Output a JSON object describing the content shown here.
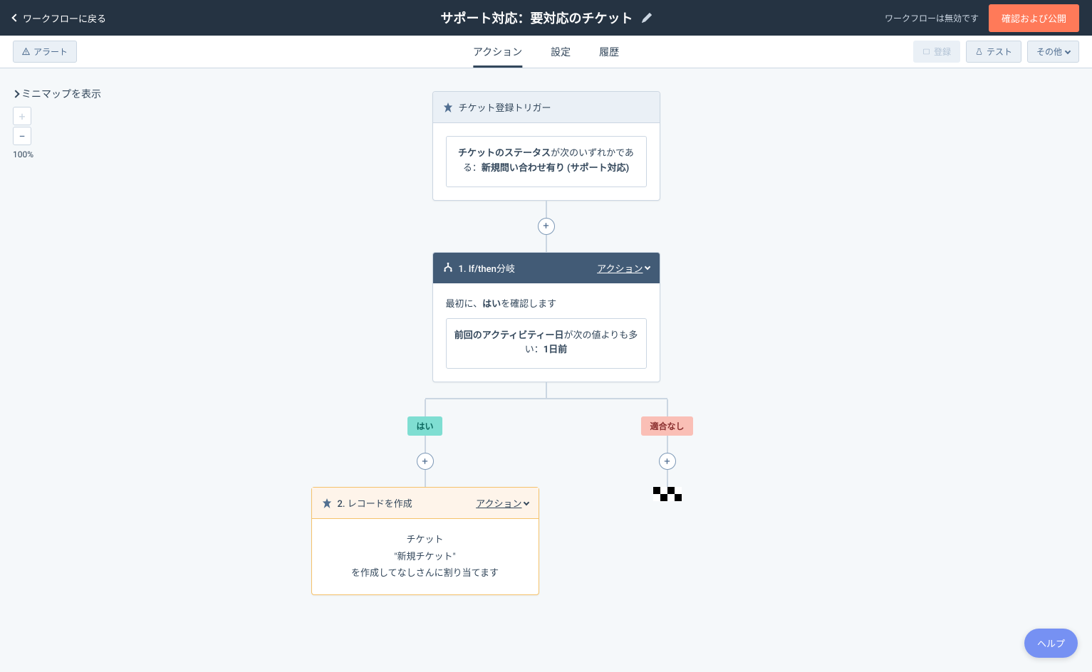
{
  "header": {
    "back_label": "ワークフローに戻る",
    "title": "サポート対応：要対応のチケット",
    "disabled_text": "ワークフローは無効です",
    "publish_label": "確認および公開"
  },
  "subheader": {
    "alerts_label": "アラート",
    "tabs": {
      "action": "アクション",
      "settings": "設定",
      "history": "履歴"
    },
    "register_label": "登録",
    "test_label": "テスト",
    "more_label": "その他"
  },
  "canvas": {
    "minimap_toggle": "ミニマップを表示",
    "zoom_level": "100%"
  },
  "trigger": {
    "title": "チケット登録トリガー",
    "condition_prefix": "チケットのステータス",
    "condition_mid": "が次のいずれかである：",
    "condition_value": "新規問い合わせ有り (サポート対応)"
  },
  "branch": {
    "title": "1. If/then分岐",
    "action_label": "アクション",
    "intro_prefix": "最初に、",
    "intro_bold": "はい",
    "intro_suffix": "を確認します",
    "condition_prefix": "前回のアクティビティー日",
    "condition_mid": "が次の値よりも多い：",
    "condition_value": "1日前",
    "yes_label": "はい",
    "no_label": "適合なし"
  },
  "record": {
    "title": "2. レコードを作成",
    "action_label": "アクション",
    "line1": "チケット",
    "line2": "\"新規チケット\"",
    "line3": "を作成してなしさんに割り当てます"
  },
  "help_label": "ヘルプ"
}
